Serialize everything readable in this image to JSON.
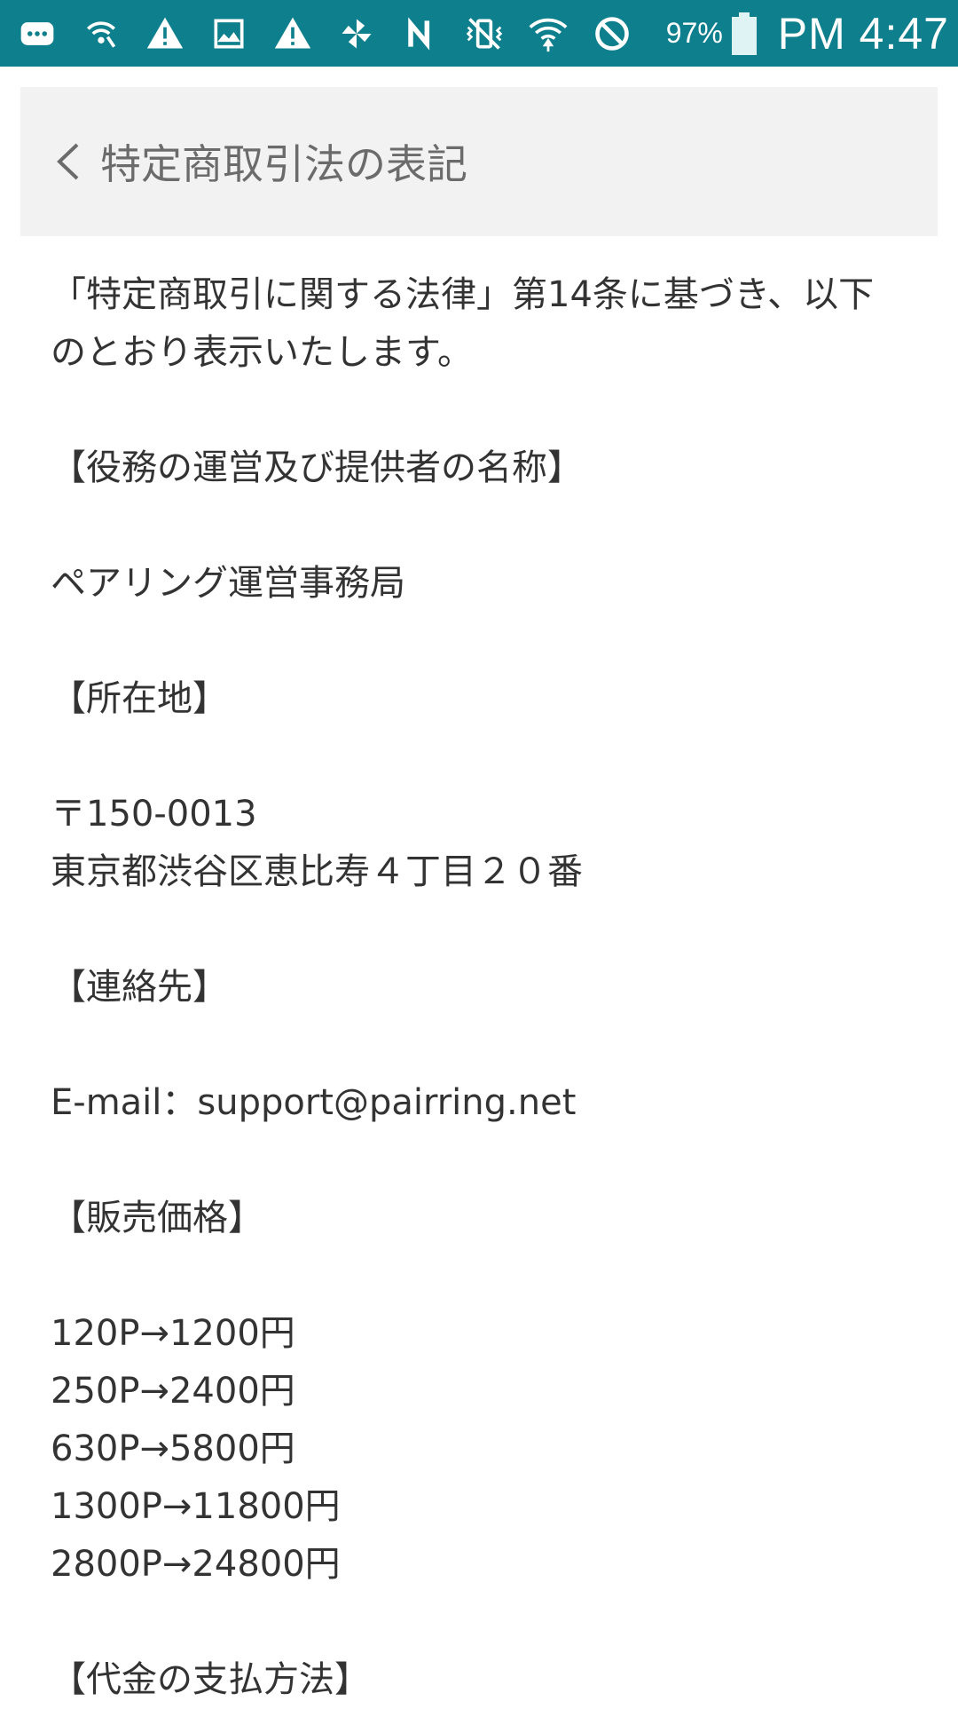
{
  "status_bar": {
    "icons": [
      "message-icon",
      "wifi-call-icon",
      "warning-icon",
      "image-icon",
      "warning-icon",
      "pinwheel-icon",
      "nfc-icon",
      "vibrate-icon",
      "wifi-icon",
      "blocked-icon"
    ],
    "battery": "97%",
    "time": "PM 4:47",
    "color": "#0e7f8c"
  },
  "header": {
    "title": "特定商取引法の表記",
    "back_icon": "chevron-left-icon"
  },
  "content": {
    "intro_line1": "「特定商取引に関する法律」第14条に基づき、以下",
    "intro_line2": "のとおり表示いたします。",
    "sections": {
      "provider_heading": "【役務の運営及び提供者の名称】",
      "provider_name": "ペアリング運営事務局",
      "address_heading": "【所在地】",
      "postal_code": "〒150-0013",
      "address": "東京都渋谷区恵比寿４丁目２０番",
      "contact_heading": "【連絡先】",
      "email": "E-mail：support@pairring.net",
      "price_heading": "【販売価格】",
      "prices": [
        "120P→1200円",
        "250P→2400円",
        "630P→5800円",
        "1300P→11800円",
        "2800P→24800円"
      ],
      "payment_heading": "【代金の支払方法】"
    }
  }
}
